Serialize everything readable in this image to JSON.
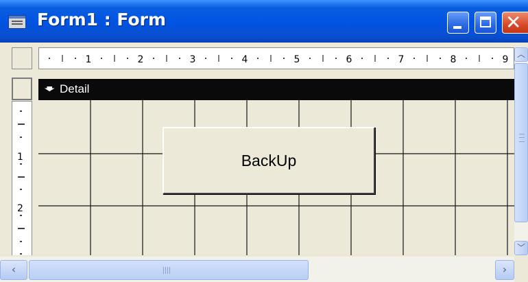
{
  "window": {
    "title": "Form1 : Form",
    "app_icon": "form-design-icon",
    "controls": [
      "minimize-icon",
      "maximize-icon",
      "close-icon"
    ]
  },
  "ruler": {
    "horizontal_marks": [
      "1",
      "2",
      "3",
      "4",
      "5",
      "6",
      "7",
      "8",
      "9"
    ],
    "vertical_marks": [
      "1",
      "2"
    ]
  },
  "section": {
    "icon": "section-expand-icon",
    "label": "Detail"
  },
  "form_button": {
    "label": "BackUp"
  },
  "colors": {
    "titlebar": "#0054e3",
    "section_bar": "#0a0a0a",
    "grid_background": "#ece9d8",
    "grid_lines": "#141414"
  }
}
